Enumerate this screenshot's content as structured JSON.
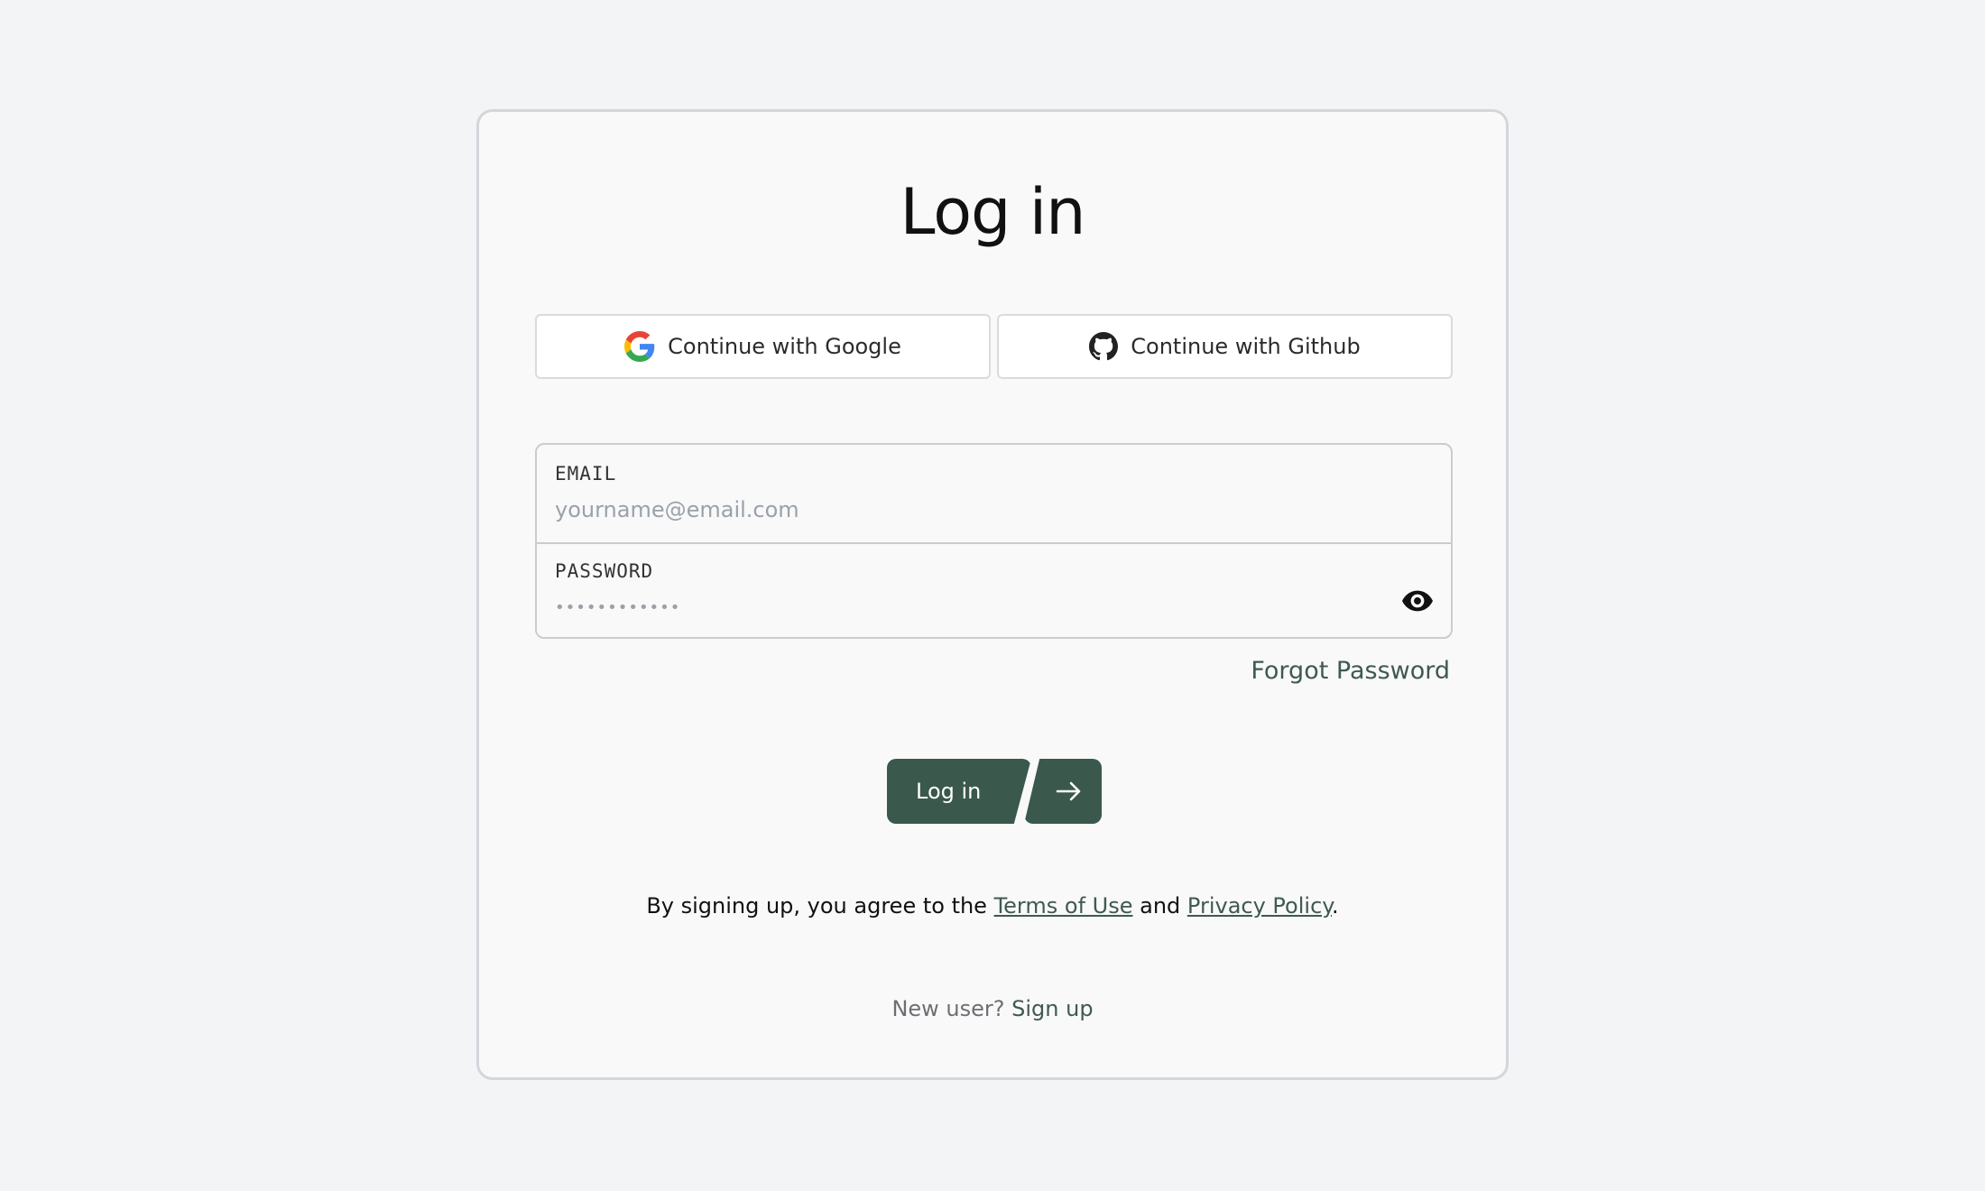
{
  "login": {
    "title": "Log in",
    "google_button": "Continue with Google",
    "github_button": "Continue with Github",
    "email_label": "EMAIL",
    "email_placeholder": "yourname@email.com",
    "password_label": "PASSWORD",
    "password_placeholder": "••••••••••••",
    "forgot_password": "Forgot Password",
    "submit_label": "Log in",
    "terms_prefix": "By signing up, you agree to the ",
    "terms_link": "Terms of Use",
    "terms_and": " and ",
    "privacy_link": "Privacy Policy",
    "terms_suffix": ".",
    "new_user_text": "New user? ",
    "signup_link": "Sign up"
  },
  "colors": {
    "accent": "#3a584c",
    "background": "#f3f4f6",
    "card": "#f9f9f9"
  },
  "icons": {
    "google": "google-logo-icon",
    "github": "github-logo-icon",
    "eye": "eye-icon",
    "arrow": "arrow-right-icon"
  }
}
